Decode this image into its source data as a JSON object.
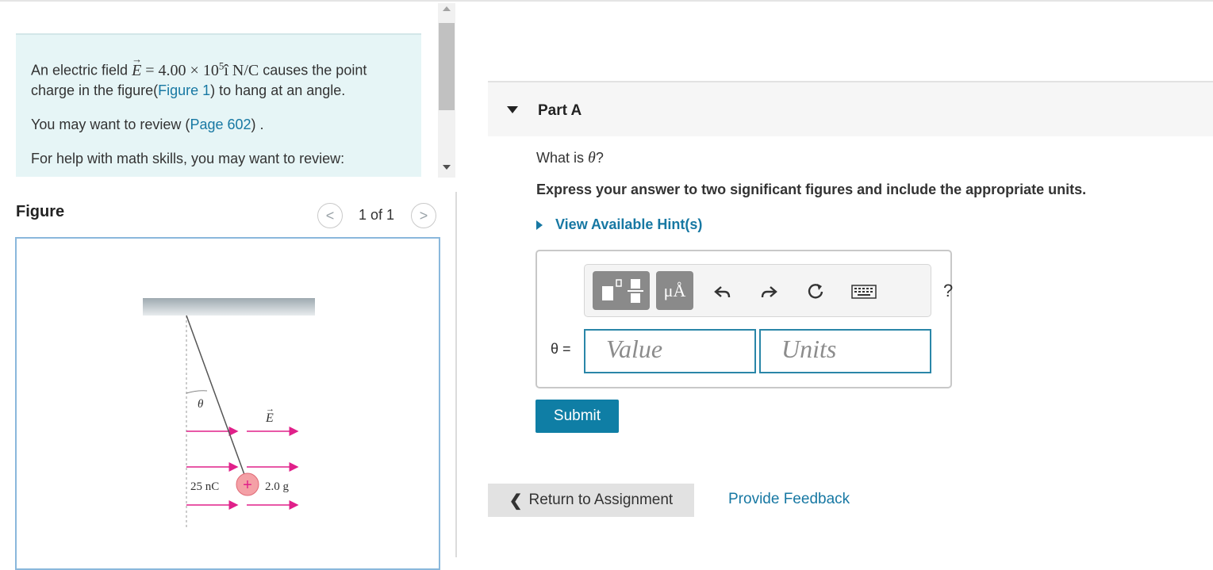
{
  "problem": {
    "line1_pre": "An electric field ",
    "field_symbol": "E",
    "field_expr": " = 4.00 × 10",
    "field_exp": "5",
    "field_unit": "î N/C",
    "line1_post": " causes the point charge in the figure(",
    "figure_link": "Figure 1",
    "line1_end": ") to hang at an angle.",
    "review_pre": "You may want to review (",
    "review_link": "Page 602",
    "review_post": ") .",
    "math_help": "For help with math skills, you may want to review:"
  },
  "figure": {
    "label": "Figure",
    "pager": "1 of 1",
    "prev_glyph": "<",
    "next_glyph": ">",
    "theta_label": "θ",
    "field_label": "E",
    "charge_label": "25 nC",
    "charge_sign": "+",
    "mass_label": "2.0 g"
  },
  "part": {
    "title": "Part A",
    "question_pre": "What is ",
    "question_var": "θ",
    "question_post": "?",
    "instruction": "Express your answer to two significant figures and include the appropriate units.",
    "hints_label": "View Available Hint(s)"
  },
  "answer": {
    "var_label": "θ =",
    "value_placeholder": "Value",
    "units_placeholder": "Units",
    "toolbar_units_label": "μÅ",
    "help_label": "?"
  },
  "actions": {
    "submit_label": "Submit",
    "return_label": "Return to Assignment",
    "feedback_label": "Provide Feedback"
  },
  "colors": {
    "accent": "#1778a3",
    "submit_bg": "#0f7ea5",
    "field_arrows": "#e0208a",
    "charge_fill": "#f4a0a6"
  }
}
